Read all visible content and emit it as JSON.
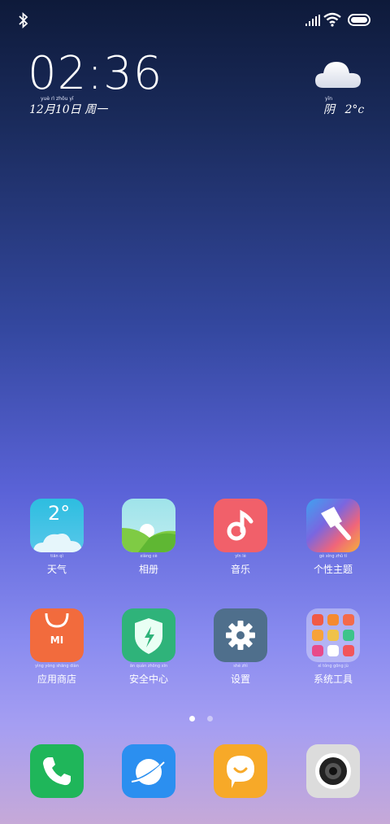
{
  "status_bar": {
    "bluetooth": "bluetooth-icon",
    "signal": "signal-icon",
    "wifi": "wifi-icon",
    "battery": "battery-icon"
  },
  "clock": {
    "time": "02:36",
    "date": "12月10日 周一",
    "date_pinyin": "yuè  rì   zhōu  yī"
  },
  "weather": {
    "condition": "阴",
    "temp": "2°c",
    "cond_pinyin": "yīn"
  },
  "apps_row1": [
    {
      "name": "天气",
      "pinyin": "tiān  qì",
      "icon": "weather-icon",
      "badge": "2°"
    },
    {
      "name": "相册",
      "pinyin": "xiàng  cè",
      "icon": "gallery-icon"
    },
    {
      "name": "音乐",
      "pinyin": "yīn  lè",
      "icon": "music-icon"
    },
    {
      "name": "个性主题",
      "pinyin": "gè  xìng  zhǔ  tí",
      "icon": "theme-icon"
    }
  ],
  "apps_row2": [
    {
      "name": "应用商店",
      "pinyin": "yìng yòng shāng diàn",
      "icon": "app-store-icon",
      "badge": "MI"
    },
    {
      "name": "安全中心",
      "pinyin": "ān  quán zhōng  xīn",
      "icon": "security-icon"
    },
    {
      "name": "设置",
      "pinyin": "shè  zhì",
      "icon": "settings-icon"
    },
    {
      "name": "系统工具",
      "pinyin": "xì  tǒng gōng  jù",
      "icon": "folder-icon"
    }
  ],
  "dock": [
    {
      "icon": "phone-icon"
    },
    {
      "icon": "browser-icon"
    },
    {
      "icon": "messages-icon"
    },
    {
      "icon": "camera-icon"
    }
  ],
  "colors": {
    "weather": "#3bbbd9",
    "gallery": "#8fd15a",
    "music": "#f1606a",
    "store": "#f26b3d",
    "security": "#2fb37a",
    "settings": "#4f6f8c",
    "phone": "#1fb65a",
    "browser": "#2b8ff0",
    "messages": "#f7a928",
    "camera": "#dcdcdc"
  }
}
